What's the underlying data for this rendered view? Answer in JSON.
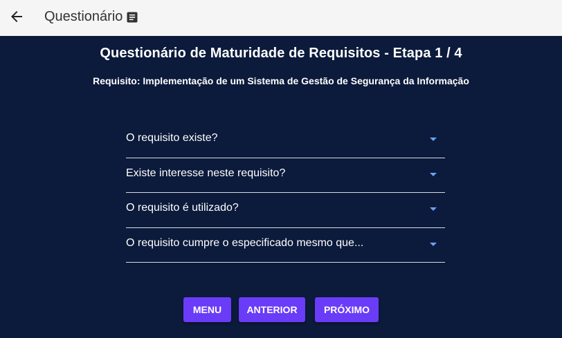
{
  "appbar": {
    "back_icon": "arrow-left-icon",
    "title": "Questionário",
    "title_icon": "document-icon"
  },
  "main": {
    "title": "Questionário de Maturidade de Requisitos - Etapa 1 / 4",
    "subtitle": "Requisito: Implementação de um Sistema de Gestão de Segurança da Informação",
    "questions": [
      {
        "label": "O requisito existe?"
      },
      {
        "label": "Existe interesse neste requisito?"
      },
      {
        "label": "O requisito é utilizado?"
      },
      {
        "label": "O requisito cumpre o especificado mesmo que..."
      }
    ]
  },
  "actions": {
    "menu_label": "MENU",
    "previous_label": "ANTERIOR",
    "next_label": "PRÓXIMO"
  },
  "colors": {
    "background": "#0c1a3b",
    "appbar": "#f5f5f5",
    "accent": "#6a3cf7",
    "caret": "#6aa3ff"
  }
}
